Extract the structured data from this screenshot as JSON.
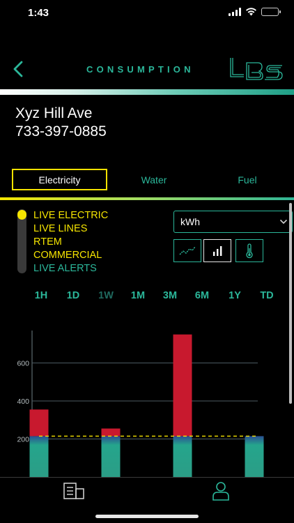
{
  "status": {
    "time": "1:43"
  },
  "header": {
    "title": "CONSUMPTION",
    "logo_text": "LBS"
  },
  "address": {
    "name": "Xyz Hill Ave",
    "phone": "733-397-0885"
  },
  "tabs": [
    {
      "label": "Electricity",
      "active": true
    },
    {
      "label": "Water",
      "active": false
    },
    {
      "label": "Fuel",
      "active": false
    }
  ],
  "feeds": [
    {
      "label": "LIVE ELECTRIC",
      "color": "yellow"
    },
    {
      "label": "LIVE LINES",
      "color": "yellow"
    },
    {
      "label": "RTEM",
      "color": "yellow"
    },
    {
      "label": "COMMERCIAL",
      "color": "yellow"
    },
    {
      "label": "LIVE ALERTS",
      "color": "green"
    }
  ],
  "unit_select": {
    "value": "kWh"
  },
  "chart_types": [
    {
      "icon": "line-chart-icon",
      "active": false
    },
    {
      "icon": "bar-chart-icon",
      "active": true
    },
    {
      "icon": "thermometer-icon",
      "active": false
    }
  ],
  "ranges": [
    {
      "label": "1H",
      "active": false
    },
    {
      "label": "1D",
      "active": false
    },
    {
      "label": "1W",
      "active": true
    },
    {
      "label": "1M",
      "active": false
    },
    {
      "label": "3M",
      "active": false
    },
    {
      "label": "6M",
      "active": false
    },
    {
      "label": "1Y",
      "active": false
    },
    {
      "label": "TD",
      "active": false
    }
  ],
  "colors": {
    "accent": "#2bb79a",
    "highlight": "#f5e400",
    "bar_high": "#c8192e",
    "bar_base": "#26a58d",
    "threshold": "#f5e400"
  },
  "chart_data": {
    "type": "bar",
    "y_ticks": [
      200,
      400,
      600
    ],
    "ylim": [
      0,
      870
    ],
    "grid": true,
    "threshold": 215,
    "series": [
      {
        "values": [
          355,
          255,
          750,
          215
        ]
      }
    ],
    "base_cap": 215
  },
  "nav": [
    {
      "icon": "building-icon"
    },
    {
      "icon": "profile-icon"
    }
  ]
}
